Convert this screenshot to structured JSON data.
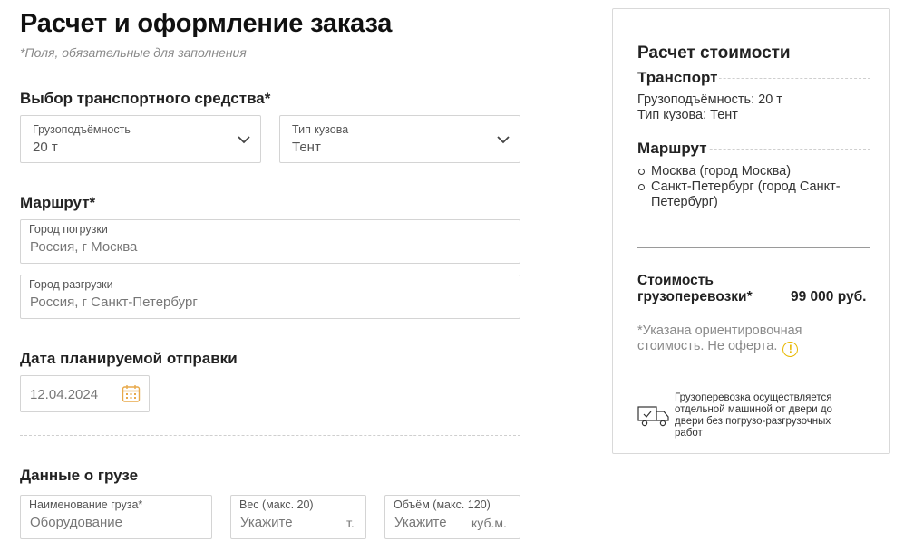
{
  "page": {
    "title": "Расчет и оформление заказа",
    "required_note": "*Поля, обязательные для заполнения"
  },
  "vehicle": {
    "section_title": "Выбор транспортного средства*",
    "capacity": {
      "label": "Грузоподъёмность",
      "value": "20 т"
    },
    "body_type": {
      "label": "Тип кузова",
      "value": "Тент"
    }
  },
  "route": {
    "section_title": "Маршрут*",
    "loading_city": {
      "label": "Город погрузки",
      "value": "Россия, г Москва"
    },
    "unloading_city": {
      "label": "Город разгрузки",
      "value": "Россия, г Санкт-Петербург"
    }
  },
  "departure": {
    "section_title": "Дата планируемой отправки",
    "date_value": "12.04.2024",
    "calendar_icon": "calendar-icon"
  },
  "cargo": {
    "section_title": "Данные о грузе",
    "name": {
      "label": "Наименование груза*",
      "placeholder": "Оборудование"
    },
    "weight": {
      "label": "Вес (макс. 20)",
      "placeholder": "Укажите",
      "unit": "т."
    },
    "volume": {
      "label": "Объём (макс. 120)",
      "placeholder": "Укажите",
      "unit": "куб.м."
    }
  },
  "summary": {
    "title": "Расчет стоимости",
    "transport_heading": "Транспорт",
    "transport_capacity": "Грузоподъёмность: 20 т",
    "transport_body": "Тип кузова: Тент",
    "route_heading": "Маршрут",
    "route_points": [
      "Москва (город Москва)",
      "Санкт-Петербург (город Санкт-Петербург)"
    ],
    "cost_label": "Стоимость грузоперевозки*",
    "cost_value": "99 000 руб.",
    "cost_note": "*Указана ориентировочная стоимость. Не оферта.",
    "warning_icon": "warning-icon",
    "warning_glyph": "!",
    "truck_icon": "truck-icon",
    "delivery_note": "Грузоперевозка осуществляется отдельной машиной от двери до двери без погрузо-разгрузочных работ"
  },
  "colors": {
    "accent_warning": "#e8b800",
    "calendar_accent": "#e8a94a",
    "border": "#d4d4d4",
    "muted_text": "#8a8a8a"
  }
}
